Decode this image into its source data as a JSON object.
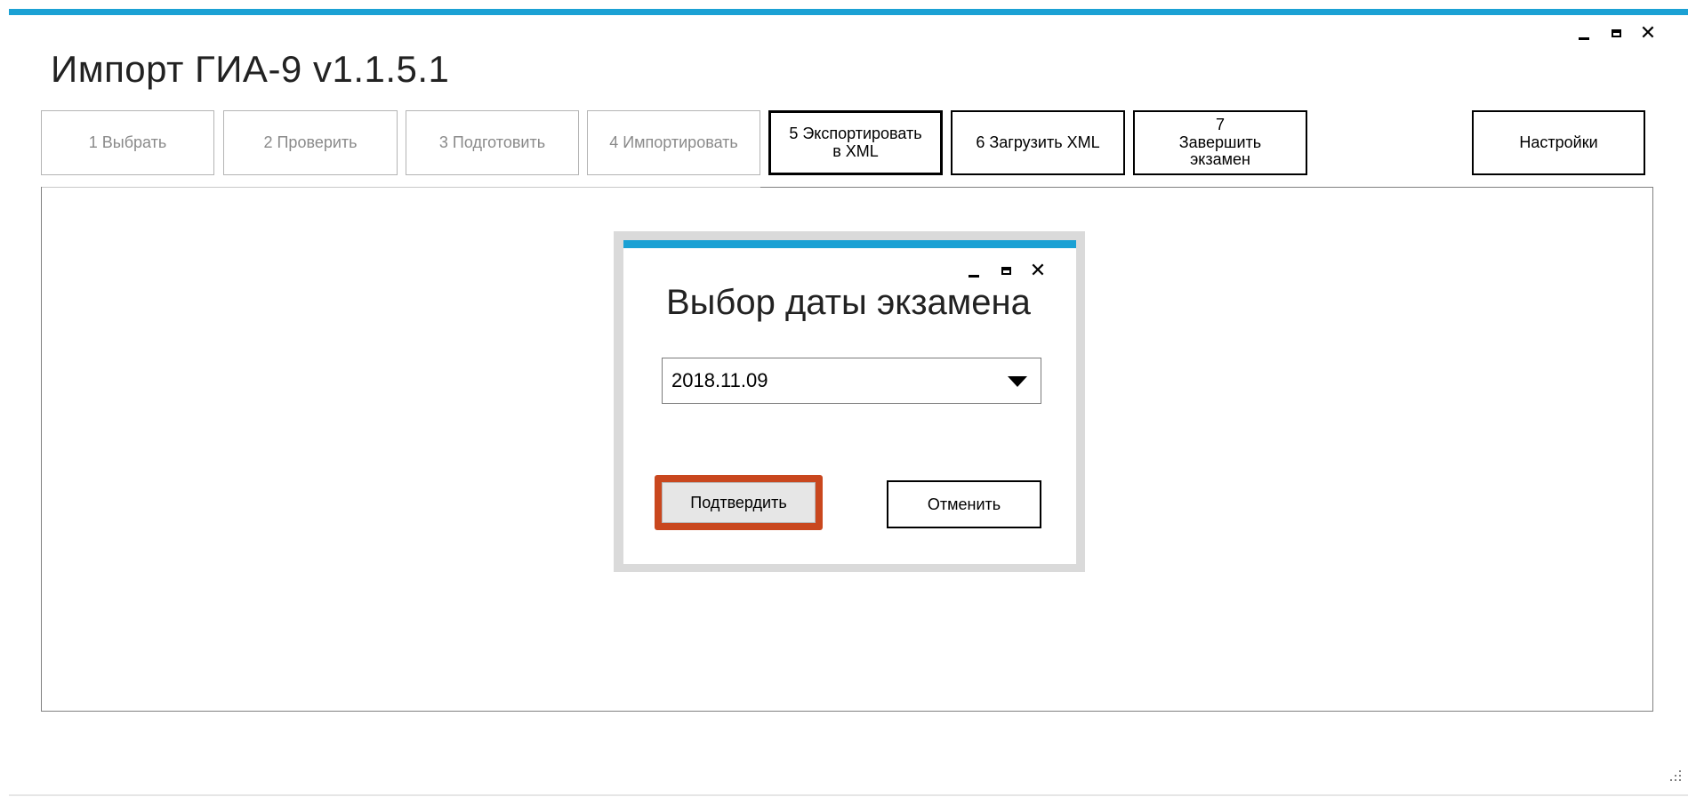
{
  "window": {
    "title": "Импорт ГИА-9 v1.1.5.1",
    "controls": {
      "minimize": "minimize-icon",
      "maximize": "maximize-icon",
      "close": "close-icon",
      "close_glyph": "✕"
    }
  },
  "steps": [
    {
      "label": "1   Выбрать",
      "enabled": false
    },
    {
      "label": "2   Проверить",
      "enabled": false
    },
    {
      "label": "3  Подготовить",
      "enabled": false
    },
    {
      "label": "4 Импортировать",
      "enabled": false
    },
    {
      "label": "5 Экспортировать в XML",
      "enabled": true,
      "focused": true
    },
    {
      "label": "6 Загрузить XML",
      "enabled": true
    },
    {
      "label": "7 Завершить экзамен",
      "enabled": true
    }
  ],
  "settings": {
    "label": "Настройки"
  },
  "dialog": {
    "title": "Выбор даты экзамена",
    "date_select": {
      "value": "2018.11.09"
    },
    "confirm_label": "Подтвердить",
    "cancel_label": "Отменить",
    "highlight_color": "#c9471e"
  },
  "colors": {
    "accent": "#1ba1d4"
  }
}
